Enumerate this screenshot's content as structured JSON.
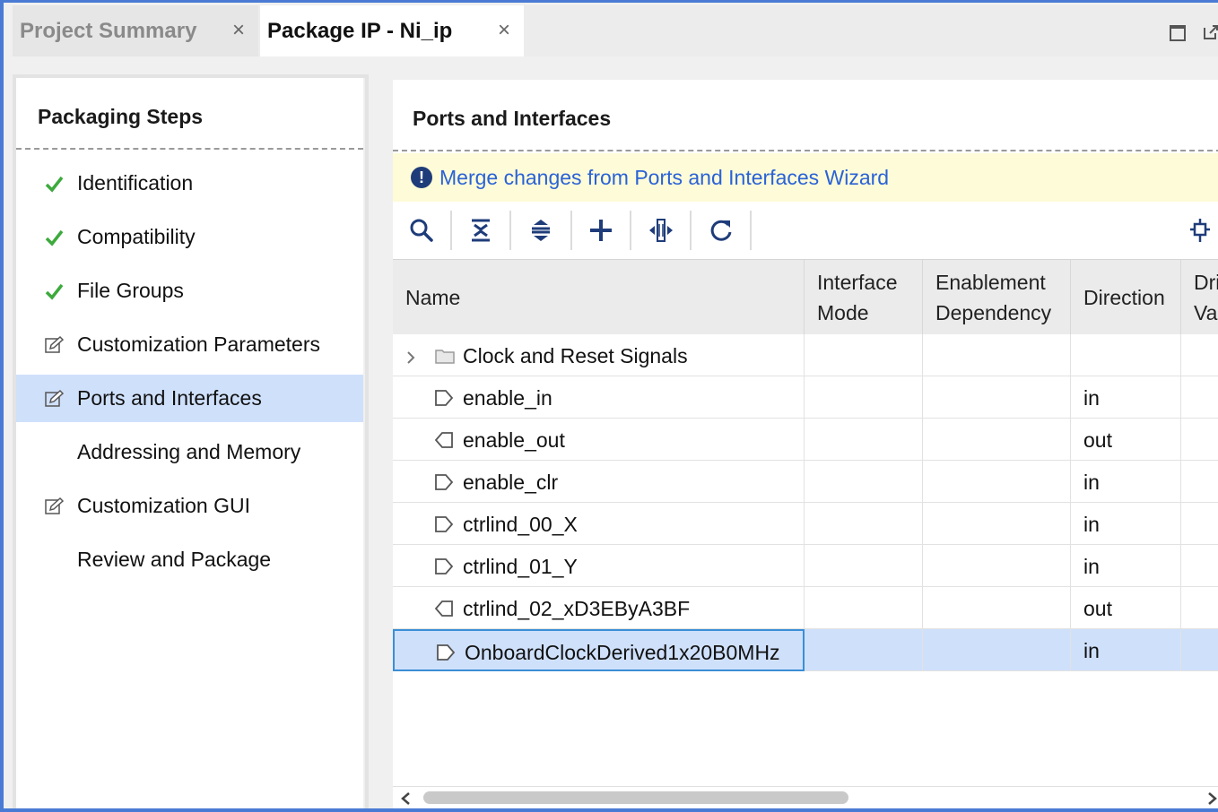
{
  "tabs": [
    {
      "label": "Project Summary",
      "active": false
    },
    {
      "label": "Package IP - Ni_ip",
      "active": true
    }
  ],
  "tab_close_glyph": "×",
  "packaging_steps": {
    "title": "Packaging Steps",
    "items": [
      {
        "label": "Identification",
        "icon": "check-icon",
        "selected": false
      },
      {
        "label": "Compatibility",
        "icon": "check-icon",
        "selected": false
      },
      {
        "label": "File Groups",
        "icon": "check-icon",
        "selected": false
      },
      {
        "label": "Customization Parameters",
        "icon": "edit-icon",
        "selected": false
      },
      {
        "label": "Ports and Interfaces",
        "icon": "edit-icon",
        "selected": true
      },
      {
        "label": "Addressing and Memory",
        "icon": "",
        "selected": false
      },
      {
        "label": "Customization GUI",
        "icon": "edit-icon",
        "selected": false
      },
      {
        "label": "Review and Package",
        "icon": "",
        "selected": false
      }
    ]
  },
  "ports": {
    "title": "Ports and Interfaces",
    "banner": {
      "icon": "info-icon",
      "text": "Merge changes from Ports and Interfaces Wizard"
    },
    "toolbar": [
      "search-icon",
      "collapse-all-icon",
      "expand-all-icon",
      "add-icon",
      "auto-infer-icon",
      "refresh-icon",
      "settings-icon"
    ],
    "columns": [
      "Name",
      "Interface\nMode",
      "Enablement\nDependency",
      "Direction",
      "Dri\nVa"
    ],
    "rows": [
      {
        "name": "Clock and Reset Signals",
        "type": "folder",
        "direction": "",
        "selected": false
      },
      {
        "name": "enable_in",
        "type": "in-port",
        "direction": "in",
        "selected": false
      },
      {
        "name": "enable_out",
        "type": "out-port",
        "direction": "out",
        "selected": false
      },
      {
        "name": "enable_clr",
        "type": "in-port",
        "direction": "in",
        "selected": false
      },
      {
        "name": "ctrlind_00_X",
        "type": "in-port",
        "direction": "in",
        "selected": false
      },
      {
        "name": "ctrlind_01_Y",
        "type": "in-port",
        "direction": "in",
        "selected": false
      },
      {
        "name": "ctrlind_02_xD3EByA3BF",
        "type": "out-port",
        "direction": "out",
        "selected": false
      },
      {
        "name": "OnboardClockDerived1x20B0MHz",
        "type": "in-port",
        "direction": "in",
        "selected": true
      }
    ]
  },
  "colors": {
    "accent": "#4a7bd4",
    "selection": "#cfe0fb",
    "check": "#3caa3c",
    "link": "#2a62d6",
    "banner_bg": "#fdfbd8"
  }
}
